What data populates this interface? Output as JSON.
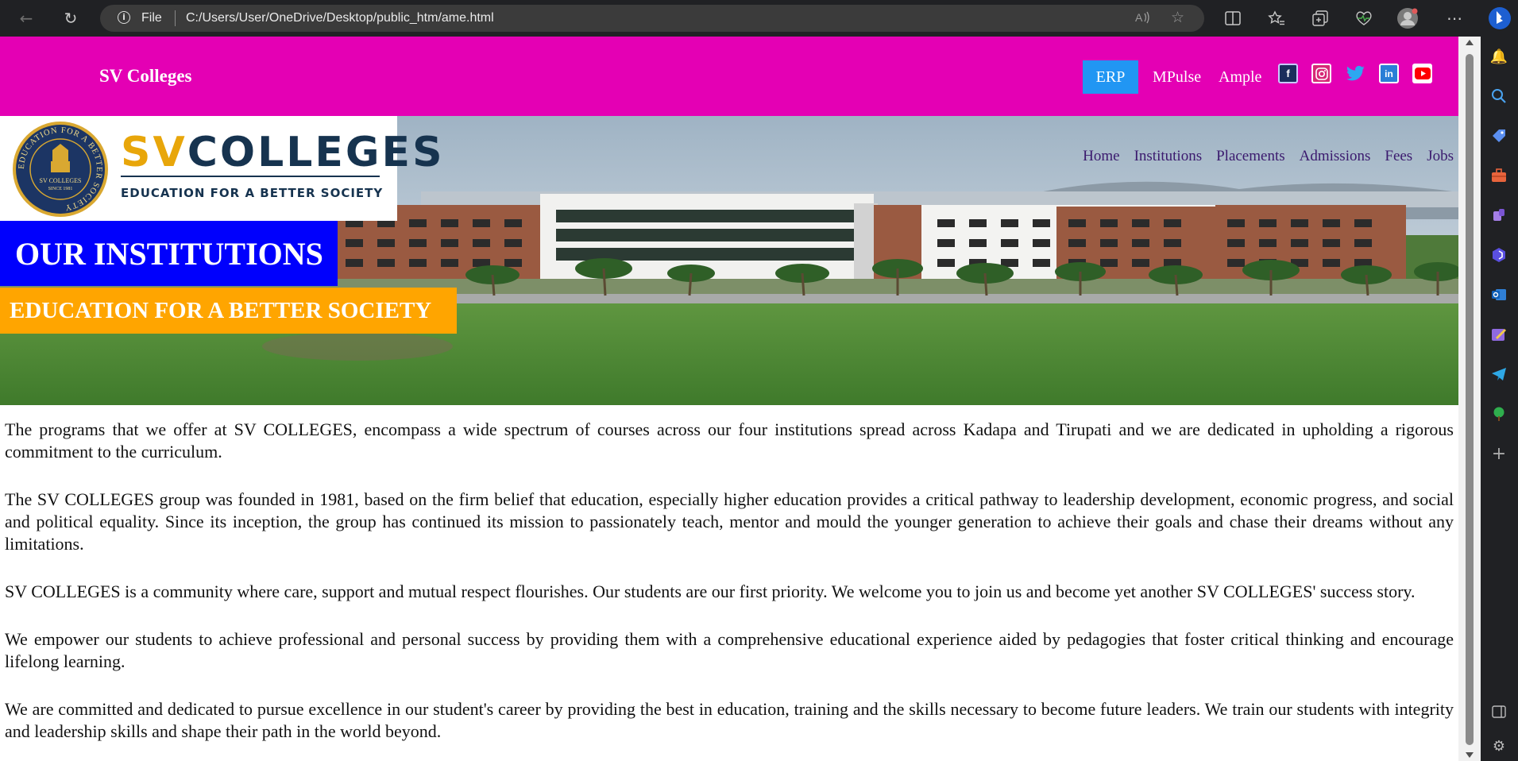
{
  "browser": {
    "scheme": "File",
    "url": "C:/Users/User/OneDrive/Desktop/public_htm/ame.html",
    "icons": [
      "back-icon",
      "refresh-icon",
      "info-icon",
      "read-aloud-icon",
      "favorite-star-icon",
      "split-screen-icon",
      "favorites-icon",
      "collections-icon",
      "health-icon",
      "profile-icon",
      "more-icon",
      "bing-icon"
    ]
  },
  "sidebar": {
    "icons": [
      "bell-icon",
      "search-icon",
      "shopping-tag-icon",
      "tools-icon",
      "games-icon",
      "copilot-icon",
      "outlook-icon",
      "designer-icon",
      "telegram-icon",
      "tree-icon",
      "add-icon",
      "sidebar-toggle-icon",
      "settings-icon"
    ]
  },
  "header": {
    "brand": "SV Colleges",
    "links": [
      "ERP",
      "MPulse",
      "Ample"
    ],
    "social": [
      "facebook-icon",
      "instagram-icon",
      "twitter-icon",
      "linkedin-icon",
      "youtube-icon"
    ]
  },
  "logo": {
    "name_highlight": "SV",
    "name_rest": "COLLEGES",
    "tagline": "EDUCATION FOR A BETTER SOCIETY",
    "seal_ring_text": "EDUCATION FOR A BETTER SOCIETY",
    "seal_center_name": "SV COLLEGES",
    "seal_center_since": "SINCE 1981"
  },
  "nav": [
    "Home",
    "Institutions",
    "Placements",
    "Admissions",
    "Fees",
    "Jobs"
  ],
  "hero": {
    "heading": "OUR INSTITUTIONS",
    "subheading": "EDUCATION FOR A BETTER SOCIETY"
  },
  "paragraphs": [
    "The programs that we offer at SV COLLEGES, encompass a wide spectrum of courses across our four institutions spread across Kadapa and Tirupati and we are dedicated in upholding a rigorous commitment to the curriculum.",
    "The SV COLLEGES group was founded in 1981, based on the firm belief that education, especially higher education provides a critical pathway to leadership development, economic progress, and social and political equality. Since its inception, the group has continued its mission to passionately teach, mentor and mould the younger generation to achieve their goals and chase their dreams without any limitations.",
    "SV COLLEGES is a community where care, support and mutual respect flourishes. Our students are our first priority. We welcome you to join us and become yet another SV COLLEGES' success story.",
    "We empower our students to achieve professional and personal success by providing them with a comprehensive educational experience aided by pedagogies that foster critical thinking and encourage lifelong learning.",
    "We are committed and dedicated to pursue excellence in our student's career by providing the best in education, training and the skills necessary to become future leaders. We train our students with integrity and leadership skills and shape their path in the world beyond."
  ],
  "colors": {
    "topbar": "#e400b4",
    "erp_button": "#2196f3",
    "heading_bg": "#0000fd",
    "subheading_bg": "#ffa500",
    "nav_text": "#3b1a6e"
  }
}
